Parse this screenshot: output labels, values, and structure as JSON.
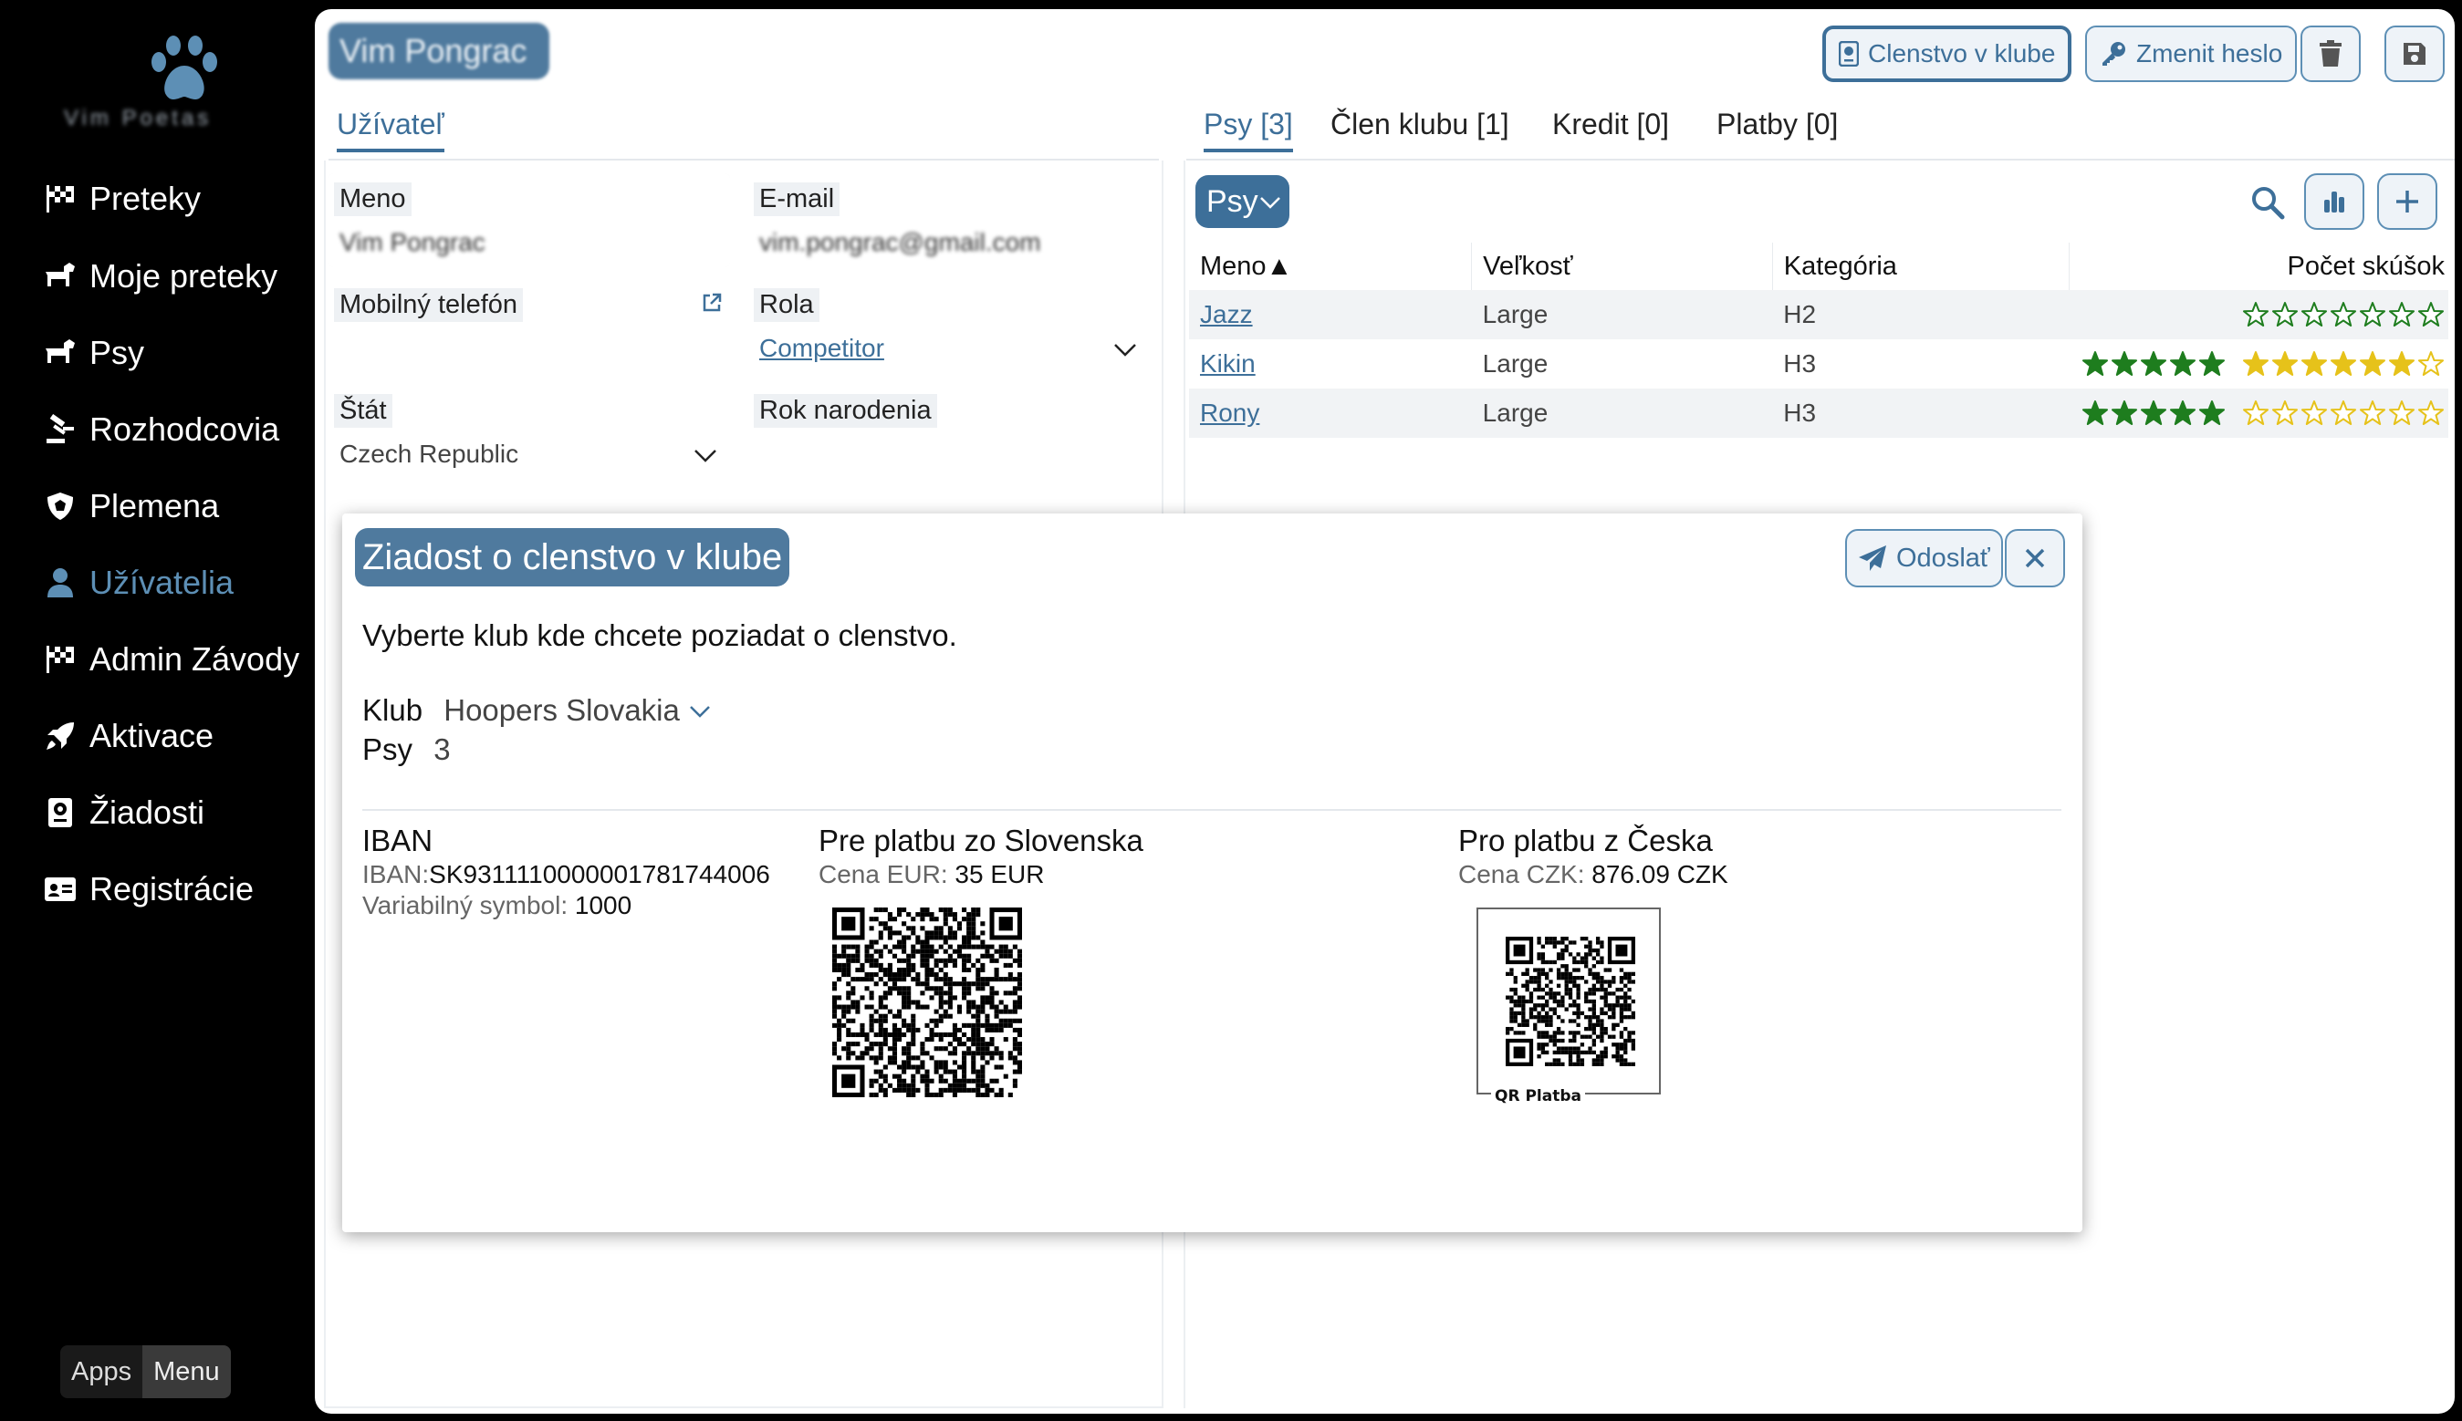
{
  "sidebar": {
    "logo_text": "Vim Poetas",
    "items": [
      {
        "label": "Preteky",
        "icon": "flag-checkered-icon"
      },
      {
        "label": "Moje preteky",
        "icon": "dog-icon"
      },
      {
        "label": "Psy",
        "icon": "dog-icon"
      },
      {
        "label": "Rozhodcovia",
        "icon": "judge-icon"
      },
      {
        "label": "Plemena",
        "icon": "shield-icon"
      },
      {
        "label": "Užívatelia",
        "icon": "user-icon",
        "active": true
      },
      {
        "label": "Admin Závody",
        "icon": "flag-checkered-icon"
      },
      {
        "label": "Aktivace",
        "icon": "rocket-icon"
      },
      {
        "label": "Žiadosti",
        "icon": "passport-icon"
      },
      {
        "label": "Registrácie",
        "icon": "id-card-icon"
      }
    ],
    "apps_label": "Apps",
    "menu_label": "Menu"
  },
  "header": {
    "user_name": "Vim Pongrac",
    "buttons": {
      "membership": "Clenstvo v klube",
      "change_password": "Zmenit heslo"
    }
  },
  "left": {
    "tab": "Užívateľ",
    "fields": {
      "name_label": "Meno",
      "name_value": "Vim Pongrac",
      "email_label": "E-mail",
      "email_value": "vim.pongrac@gmail.com",
      "phone_label": "Mobilný telefón",
      "phone_value": "",
      "role_label": "Rola",
      "role_value": "Competitor",
      "country_label": "Štát",
      "country_value": "Czech Republic",
      "birth_label": "Rok narodenia",
      "birth_value": ""
    }
  },
  "right": {
    "tabs": [
      "Psy [3]",
      "Člen klubu [1]",
      "Kredit [0]",
      "Platby [0]"
    ],
    "dropdown": "Psy",
    "table": {
      "headers": [
        "Meno▲",
        "Veľkosť",
        "Kategória",
        "Počet skúšok"
      ],
      "rows": [
        {
          "name": "Jazz",
          "size": "Large",
          "category": "H2",
          "green_stars": 0,
          "yellow_stars": 0
        },
        {
          "name": "Kikin",
          "size": "Large",
          "category": "H3",
          "green_stars": 5,
          "yellow_stars": 6
        },
        {
          "name": "Rony",
          "size": "Large",
          "category": "H3",
          "green_stars": 5,
          "yellow_stars": 0
        }
      ]
    }
  },
  "dialog": {
    "title": "Ziadost o clenstvo v klube",
    "send_label": "Odoslať",
    "text": "Vyberte klub kde chcete poziadat o clenstvo.",
    "club_label": "Klub",
    "club_value": "Hoopers Slovakia",
    "dogs_label": "Psy",
    "dogs_value": "3",
    "iban_title": "IBAN",
    "iban_prefix": "IBAN:",
    "iban_value": "SK9311110000001781744006",
    "vs_label": "Variabilný symbol:",
    "vs_value": "1000",
    "sk_title": "Pre platbu zo Slovenska",
    "sk_price_label": "Cena EUR:",
    "sk_price_value": "35 EUR",
    "cz_title": "Pro platbu z Česka",
    "cz_price_label": "Cena CZK:",
    "cz_price_value": "876.09 CZK",
    "qr_label": "QR Platba"
  },
  "colors": {
    "accent": "#3d6f99",
    "accent_light": "#5d8fb5",
    "star_green": "#1e7d1e",
    "star_yellow": "#e6c21a"
  }
}
